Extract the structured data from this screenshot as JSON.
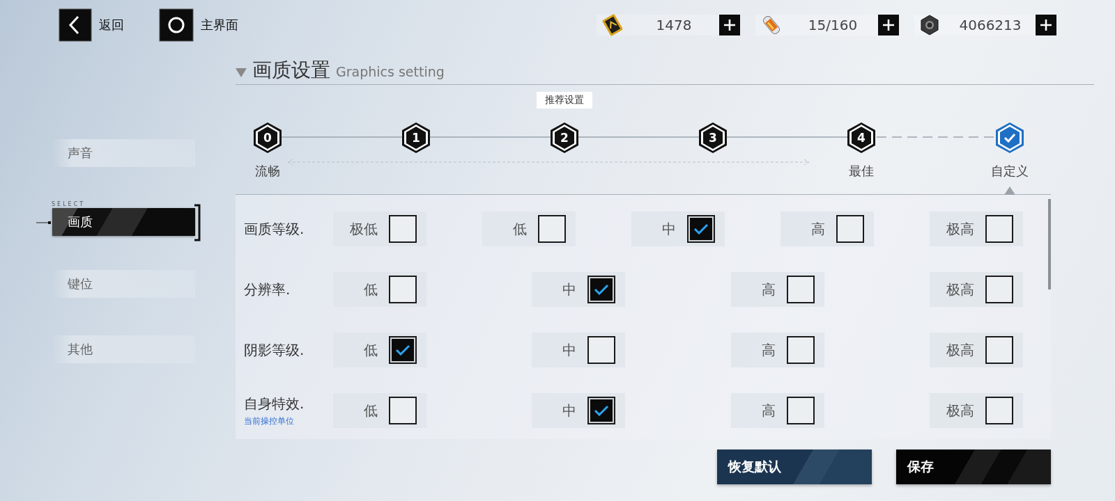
{
  "nav": {
    "back_label": "返回",
    "home_label": "主界面"
  },
  "currencies": [
    {
      "kind": "card",
      "amount": "1478"
    },
    {
      "kind": "capsule",
      "amount": "15/160"
    },
    {
      "kind": "nut",
      "amount": "4066213"
    }
  ],
  "sidebar": {
    "select_caption": "SELECT",
    "items": [
      {
        "label": "声音",
        "selected": false
      },
      {
        "label": "画质",
        "selected": true
      },
      {
        "label": "键位",
        "selected": false
      },
      {
        "label": "其他",
        "selected": false
      }
    ]
  },
  "section": {
    "title": "画质设置",
    "subtitle": "Graphics setting"
  },
  "presets": {
    "steps": [
      {
        "kind": "level",
        "number": "0",
        "label": "流畅",
        "selected": false
      },
      {
        "kind": "level",
        "number": "1",
        "selected": false
      },
      {
        "kind": "level",
        "number": "2",
        "tooltip": "推荐设置",
        "selected": false
      },
      {
        "kind": "level",
        "number": "3",
        "selected": false
      },
      {
        "kind": "level",
        "number": "4",
        "label": "最佳",
        "selected": false
      },
      {
        "kind": "custom",
        "label": "自定义",
        "selected": true
      }
    ]
  },
  "settings": [
    {
      "label": "画质等级.",
      "options": [
        {
          "label": "极低",
          "checked": false
        },
        {
          "label": "低",
          "checked": false
        },
        {
          "label": "中",
          "checked": true
        },
        {
          "label": "高",
          "checked": false
        },
        {
          "label": "极高",
          "checked": false
        }
      ]
    },
    {
      "label": "分辨率.",
      "options": [
        {
          "label": "低",
          "checked": false
        },
        {
          "label": "中",
          "checked": true
        },
        {
          "label": "高",
          "checked": false
        },
        {
          "label": "极高",
          "checked": false
        }
      ]
    },
    {
      "label": "阴影等级.",
      "options": [
        {
          "label": "低",
          "checked": true
        },
        {
          "label": "中",
          "checked": false
        },
        {
          "label": "高",
          "checked": false
        },
        {
          "label": "极高",
          "checked": false
        }
      ]
    },
    {
      "label": "自身特效.",
      "note": "当前操控单位",
      "options": [
        {
          "label": "低",
          "checked": false
        },
        {
          "label": "中",
          "checked": true
        },
        {
          "label": "高",
          "checked": false
        },
        {
          "label": "极高",
          "checked": false
        }
      ]
    }
  ],
  "buttons": [
    {
      "kind": "secondary",
      "label": "恢复默认"
    },
    {
      "kind": "primary",
      "label": "保存"
    }
  ]
}
